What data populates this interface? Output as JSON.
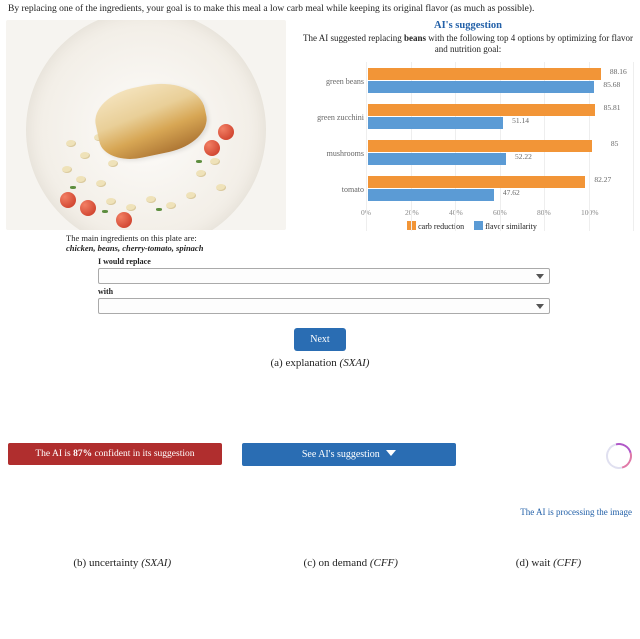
{
  "instruction": "By replacing one of the ingredients, your goal is to make this meal a low carb meal while keeping its original flavor (as much as possible).",
  "plate": {
    "ingredients_intro": "The main ingredients on this plate are:",
    "ingredients": "chicken, beans, cherry-tomato, spinach"
  },
  "form": {
    "replace_label": "I would replace",
    "with_label": "with",
    "next_button": "Next"
  },
  "ai": {
    "title": "AI's suggestion",
    "description_prefix": "The AI suggested replacing ",
    "description_bold": "beans",
    "description_suffix": " with the following top 4 options by optimizing for flavor and nutrition goal:",
    "legend_carb": "carb reduction",
    "legend_flavor": "flavor similarity"
  },
  "chart_data": {
    "type": "bar",
    "orientation": "horizontal",
    "categories": [
      "green beans",
      "green zucchini",
      "mushrooms",
      "tomato"
    ],
    "series": [
      {
        "name": "carb reduction",
        "color": "#f29537",
        "values": [
          88.16,
          85.81,
          85,
          82.27
        ]
      },
      {
        "name": "flavor similarity",
        "color": "#5b9bd5",
        "values": [
          85.68,
          51.14,
          52.22,
          47.62
        ]
      }
    ],
    "xlabel": "",
    "ylabel": "",
    "xlim": [
      0,
      100
    ],
    "ticks": [
      "0%",
      "20%",
      "40%",
      "60%",
      "80%",
      "100%"
    ]
  },
  "captions": {
    "a": "(a) explanation ",
    "a_em": "(SXAI)",
    "b": "(b) uncertainty ",
    "b_em": "(SXAI)",
    "c": "(c) on demand ",
    "c_em": "(CFF)",
    "d": "(d) wait ",
    "d_em": "(CFF)"
  },
  "panel_b": {
    "text_pre": "The AI is ",
    "pct": "87%",
    "text_post": " confident in its suggestion"
  },
  "panel_c": {
    "button": "See AI's suggestion"
  },
  "panel_d": {
    "text": "The AI is processing the image"
  }
}
